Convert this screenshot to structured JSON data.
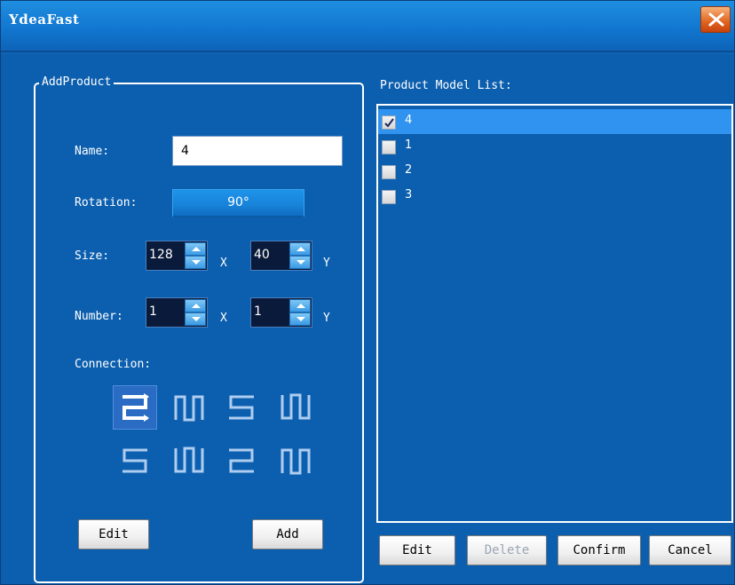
{
  "window": {
    "title": "YdeaFast"
  },
  "add_product": {
    "group_title": "AddProduct",
    "name_label": "Name:",
    "name_value": "4",
    "rotation_label": "Rotation:",
    "rotation_value": "90°",
    "size_label": "Size:",
    "size_x": "128",
    "size_y": "40",
    "number_label": "Number:",
    "number_x": "1",
    "number_y": "1",
    "x_label": "X",
    "y_label": "Y",
    "connection_label": "Connection:",
    "connection_patterns": [
      "serpentine-h-icon",
      "vertical-up-down-icon",
      "serpentine-s-icon",
      "vertical-down-up-icon",
      "serpentine-s-mirror-icon",
      "vertical-down-up-alt-icon",
      "serpentine-h-alt-icon",
      "vertical-up-down-alt-icon"
    ],
    "selected_connection": 0,
    "edit_button": "Edit",
    "add_button": "Add"
  },
  "model_list": {
    "label": "Product Model List:",
    "items": [
      {
        "label": "4",
        "checked": true,
        "selected": true
      },
      {
        "label": "1",
        "checked": false,
        "selected": false
      },
      {
        "label": "2",
        "checked": false,
        "selected": false
      },
      {
        "label": "3",
        "checked": false,
        "selected": false
      }
    ]
  },
  "bottom_buttons": {
    "edit": "Edit",
    "delete": "Delete",
    "confirm": "Confirm",
    "cancel": "Cancel"
  },
  "colors": {
    "window_bg": "#0c5fae",
    "selected_row": "#2f93ef",
    "close_button": "#e0641f"
  }
}
